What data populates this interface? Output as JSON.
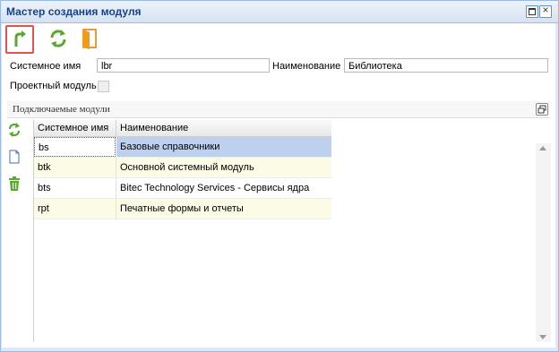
{
  "window": {
    "title": "Мастер создания модуля"
  },
  "toolbar": {
    "back_icon": "back-arrow-icon",
    "refresh_icon": "refresh-icon",
    "exit_icon": "exit-door-icon"
  },
  "form": {
    "system_name_label": "Системное имя",
    "system_name_value": "lbr",
    "name_label": "Наименование",
    "name_value": "Библиотека",
    "project_module_label": "Проектный модуль",
    "project_module_checked": false
  },
  "modules_panel": {
    "title": "Подключаемые модули",
    "side_tools": [
      "refresh-icon",
      "new-document-icon",
      "delete-trash-icon"
    ],
    "columns": [
      "Системное имя",
      "Наименование"
    ],
    "rows": [
      {
        "system_name": "bs",
        "name": "Базовые справочники",
        "selected": true
      },
      {
        "system_name": "btk",
        "name": "Основной системный модуль",
        "selected": false
      },
      {
        "system_name": "bts",
        "name": "Bitec Technology Services - Сервисы ядра",
        "selected": false
      },
      {
        "system_name": "rpt",
        "name": "Печатные формы и отчеты",
        "selected": false
      }
    ]
  },
  "colors": {
    "accent_blue": "#15428b",
    "selection": "#bdd0ee",
    "highlight_border": "#e8504d",
    "icon_green": "#5aa82d",
    "icon_orange": "#f39c12"
  }
}
